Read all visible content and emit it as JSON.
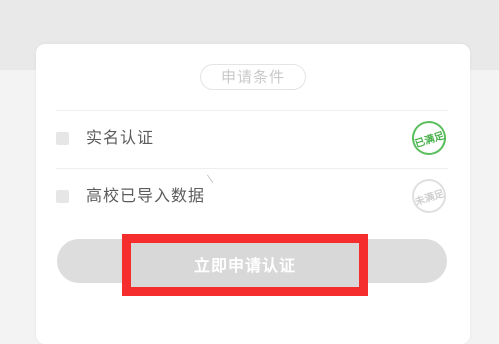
{
  "section": {
    "title": "申请条件"
  },
  "conditions": [
    {
      "label": "实名认证",
      "stamp": "已满足",
      "status": "satisfied"
    },
    {
      "label": "高校已导入数据",
      "stamp": "未满足",
      "status": "unsatisfied"
    }
  ],
  "action": {
    "submit_label": "立即申请认证"
  },
  "colors": {
    "satisfied": "#4cb050",
    "unsatisfied": "#d8d8d8",
    "highlight": "#f52d2d",
    "button": "#dddddd"
  }
}
